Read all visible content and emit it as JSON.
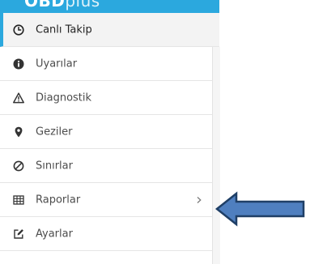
{
  "brand": {
    "part1": "OBD",
    "part2": "plus"
  },
  "menu": [
    {
      "label": "Canlı Takip",
      "icon": "clock-icon",
      "active": true
    },
    {
      "label": "Uyarılar",
      "icon": "info-circle-icon"
    },
    {
      "label": "Diagnostik",
      "icon": "warning-triangle-icon"
    },
    {
      "label": "Geziler",
      "icon": "map-marker-icon"
    },
    {
      "label": "Sınırlar",
      "icon": "ban-icon"
    },
    {
      "label": "Raporlar",
      "icon": "table-icon",
      "has_submenu": true,
      "chevron": "›"
    },
    {
      "label": "Ayarlar",
      "icon": "edit-icon"
    }
  ],
  "colors": {
    "accent": "#2ba8de",
    "arrow_fill": "#4f7fbf",
    "arrow_stroke": "#1f3f66",
    "text": "#4c4c4c"
  }
}
